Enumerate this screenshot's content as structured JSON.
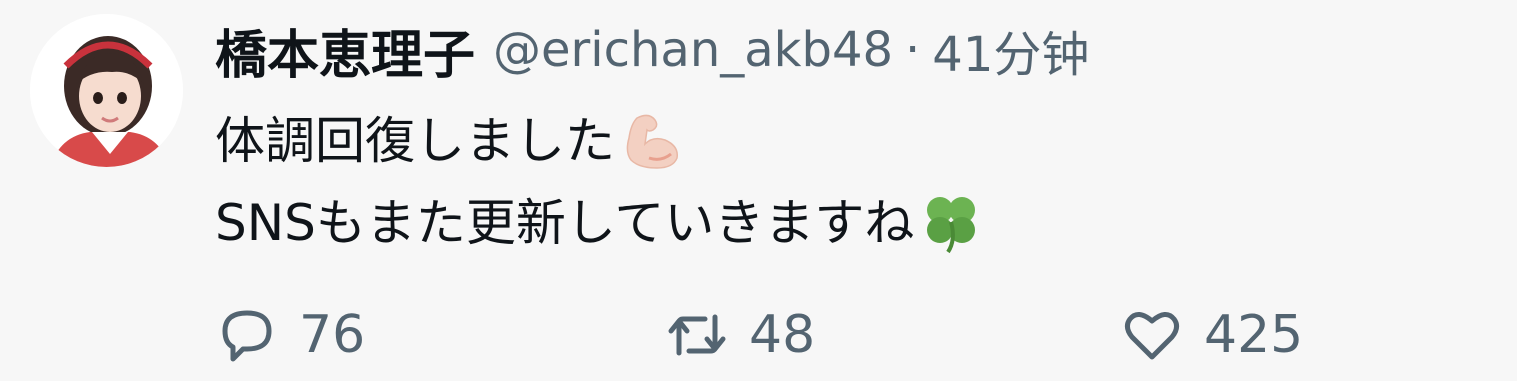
{
  "author": {
    "display_name": "橋本恵理子",
    "handle": "@erichan_akb48",
    "separator": "·",
    "time": "41分钟"
  },
  "tweet": {
    "line1": "体調回復しました",
    "line1_emoji": "flexed-biceps-emoji",
    "line2": "SNSもまた更新していきますね",
    "line2_emoji": "four-leaf-clover-emoji"
  },
  "actions": {
    "reply": {
      "icon": "reply-icon",
      "count": "76"
    },
    "retweet": {
      "icon": "retweet-icon",
      "count": "48"
    },
    "like": {
      "icon": "heart-icon",
      "count": "425"
    }
  },
  "colors": {
    "background": "#f7f7f7",
    "text_primary": "#0f1419",
    "text_secondary": "#536471"
  }
}
